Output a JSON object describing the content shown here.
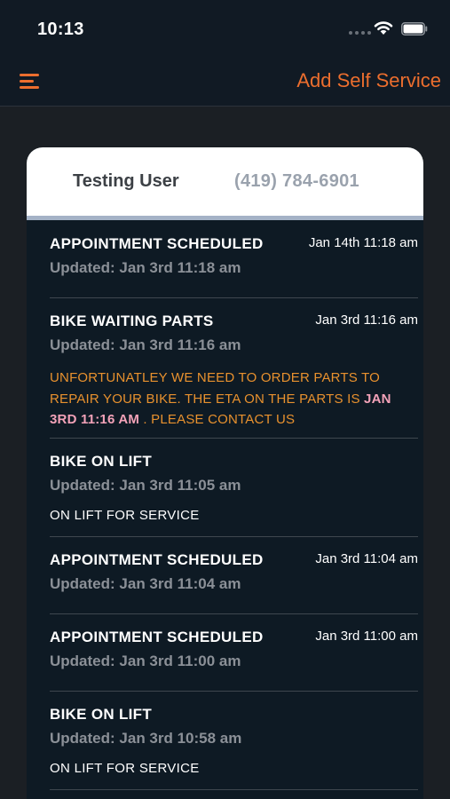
{
  "status_bar": {
    "time": "10:13"
  },
  "nav": {
    "menu_icon": "hamburger-menu-icon",
    "action_label": "Add Self Service",
    "accent": "#ec6e2e"
  },
  "customer": {
    "name": "Testing User",
    "phone": "(419) 784-6901"
  },
  "updated_label": "Updated:",
  "entries": [
    {
      "title": "APPOINTMENT SCHEDULED",
      "date": "Jan 14th 11:18 am",
      "updated": "Jan 3rd 11:18 am"
    },
    {
      "title": "BIKE WAITING PARTS",
      "date": "Jan 3rd 11:16 am",
      "updated": "Jan 3rd 11:16 am",
      "message_pre": "UNFORTUNATLEY WE NEED TO ORDER PARTS TO REPAIR YOUR BIKE. THE ETA ON THE PARTS IS ",
      "message_eta": "JAN 3RD 11:16 AM",
      "message_post": " . PLEASE CONTACT US"
    },
    {
      "title": "BIKE ON LIFT",
      "updated": "Jan 3rd 11:05 am",
      "note": "ON LIFT FOR SERVICE"
    },
    {
      "title": "APPOINTMENT SCHEDULED",
      "date": "Jan 3rd 11:04 am",
      "updated": "Jan 3rd 11:04 am"
    },
    {
      "title": "APPOINTMENT SCHEDULED",
      "date": "Jan 3rd 11:00 am",
      "updated": "Jan 3rd 11:00 am"
    },
    {
      "title": "BIKE ON LIFT",
      "updated": "Jan 3rd 10:58 am",
      "note": "ON LIFT FOR SERVICE"
    }
  ]
}
